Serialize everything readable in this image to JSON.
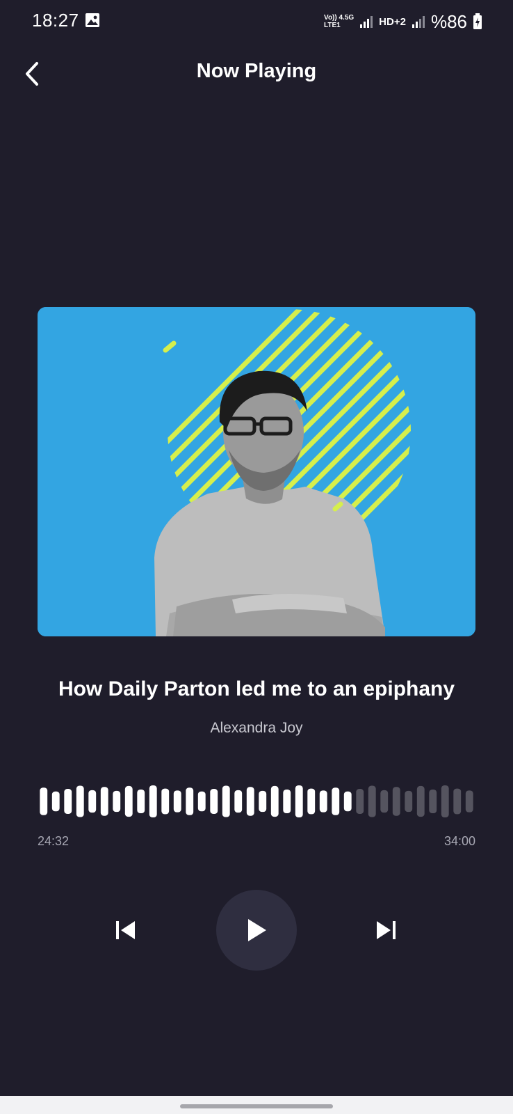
{
  "status_bar": {
    "time": "18:27",
    "network_top": "Vo)) 4.5G",
    "network_bottom": "LTE1",
    "hd_label": "HD+2",
    "battery": "%86",
    "icons": [
      "gallery-icon",
      "signal-icon",
      "battery-charging-icon"
    ]
  },
  "header": {
    "title": "Now Playing",
    "back_icon": "chevron-left-icon"
  },
  "track": {
    "title": "How Daily Parton led me to an epiphany",
    "artist": "Alexandra Joy",
    "artwork_icon": "podcast-artwork"
  },
  "player": {
    "elapsed": "24:32",
    "total": "34:00",
    "progress": 0.72,
    "controls": [
      "skip-previous-icon",
      "play-icon",
      "skip-next-icon"
    ]
  },
  "colors": {
    "background": "#1f1d2b",
    "artwork_bg": "#33a5e2",
    "stripes": "#d6ef4c",
    "wave_played": "#ffffff",
    "wave_unplayed": "#55545f",
    "play_button_bg": "#2f2e40"
  }
}
